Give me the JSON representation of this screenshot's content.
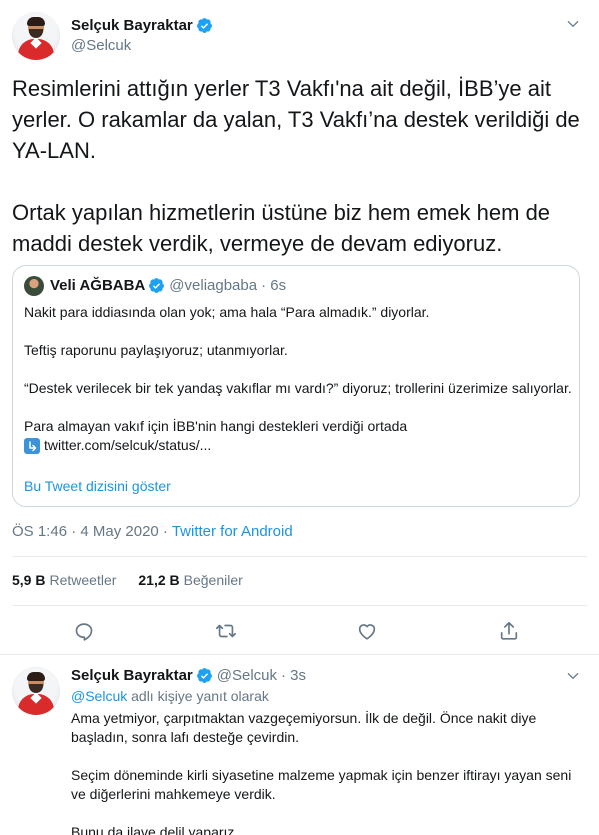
{
  "main_tweet": {
    "display_name": "Selçuk Bayraktar",
    "handle": "@Selcuk",
    "paragraphs": [
      "Resimlerini attığın yerler T3 Vakfı'na ait değil, İBB’ye ait yerler. O rakamlar da yalan, T3 Vakfı’na destek verildiği de YA-LAN.",
      "Ortak yapılan hizmetlerin üstüne biz hem emek hem de maddi destek verdik, vermeye de devam ediyoruz."
    ],
    "quote": {
      "display_name": "Veli AĞBABA",
      "handle": "@veliagbaba",
      "time": "· 6s",
      "paragraphs": [
        "Nakit para iddiasında olan yok; ama hala “Para almadık.” diyorlar.",
        "Teftiş raporunu paylaşıyoruz; utanmıyorlar.",
        "“Destek verilecek bir tek yandaş vakıflar mı vardı?” diyoruz; trollerini üzerimize salıyorlar."
      ],
      "last_paragraph": "Para almayan vakıf için İBB'nin hangi destekleri verdiği ortada",
      "link_text": "twitter.com/selcuk/status/...",
      "show_thread": "Bu Tweet dizisini göster"
    },
    "timestamp": "ÖS 1:46 · 4 May 2020 · ",
    "source": "Twitter for Android",
    "stats": {
      "retweets_count": "5,9 B",
      "retweets_label": "Retweetler",
      "likes_count": "21,2 B",
      "likes_label": "Beğeniler"
    }
  },
  "reply_tweet": {
    "display_name": "Selçuk Bayraktar",
    "handle": "@Selcuk",
    "time": "· 3s",
    "reply_mention": "@Selcuk",
    "reply_suffix": " adlı kişiye yanıt olarak",
    "paragraphs": [
      "Ama yetmiyor, çarpıtmaktan vazgeçemiyorsun. İlk de değil. Önce nakit diye başladın, sonra lafı desteğe çevirdin.",
      "Seçim döneminde kirli siyasetine malzeme yapmak için benzer iftirayı yayan seni ve diğerlerini mahkemeye verdik.",
      "Bunu da ilave delil yaparız."
    ]
  },
  "icons": {
    "verified": "verified-badge-icon",
    "chevron": "chevron-down-icon",
    "reply": "reply-icon",
    "retweet": "retweet-icon",
    "like": "heart-icon",
    "share": "share-icon",
    "link_arrow": "return-arrow-icon"
  },
  "colors": {
    "accent": "#1da1f2",
    "link": "#1b95e0",
    "secondary_text": "#657786",
    "border": "#e6ecf0"
  }
}
